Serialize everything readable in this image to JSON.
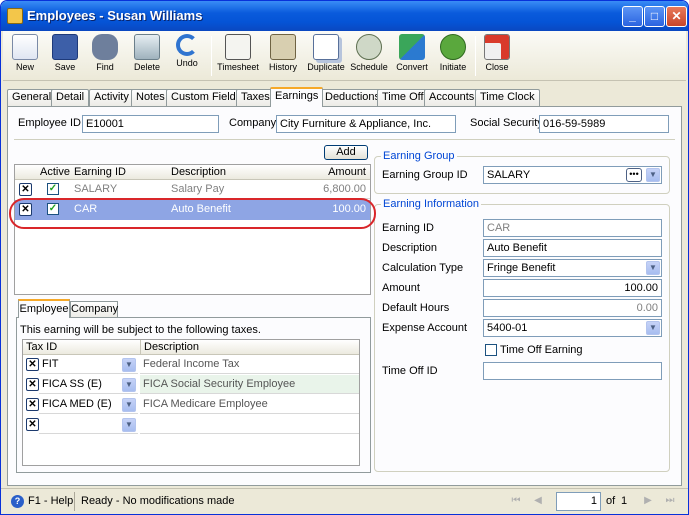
{
  "window": {
    "title": "Employees - Susan Williams"
  },
  "toolbar": {
    "new": "New",
    "save": "Save",
    "find": "Find",
    "delete": "Delete",
    "undo": "Undo",
    "timesheet": "Timesheet",
    "history": "History",
    "duplicate": "Duplicate",
    "schedule": "Schedule",
    "convert": "Convert",
    "initiate": "Initiate",
    "close": "Close"
  },
  "tabs": [
    "General",
    "Detail",
    "Activity",
    "Notes",
    "Custom Fields",
    "Taxes",
    "Earnings",
    "Deductions",
    "Time Off",
    "Accounts",
    "Time Clock"
  ],
  "header": {
    "employee_id_label": "Employee ID",
    "employee_id": "E10001",
    "company_label": "Company",
    "company": "City Furniture & Appliance, Inc.",
    "ssn_label": "Social Security",
    "ssn": "016-59-5989"
  },
  "earnings": {
    "add_label": "Add",
    "columns": [
      "Active",
      "Earning ID",
      "Description",
      "Amount"
    ],
    "rows": [
      {
        "earning_id": "SALARY",
        "description": "Salary Pay",
        "amount": "6,800.00"
      },
      {
        "earning_id": "CAR",
        "description": "Auto Benefit",
        "amount": "100.00"
      }
    ]
  },
  "subtabs": [
    "Employee",
    "Company"
  ],
  "taxes": {
    "note": "This earning will be subject to the following taxes.",
    "columns": [
      "Tax ID",
      "Description"
    ],
    "rows": [
      {
        "tax_id": "FIT",
        "description": "Federal Income Tax"
      },
      {
        "tax_id": "FICA SS (E)",
        "description": "FICA Social Security Employee"
      },
      {
        "tax_id": "FICA MED (E)",
        "description": "FICA Medicare Employee"
      }
    ]
  },
  "earning_group": {
    "title": "Earning Group",
    "id_label": "Earning Group ID",
    "id": "SALARY"
  },
  "earning_info": {
    "title": "Earning Information",
    "earning_id_label": "Earning ID",
    "earning_id": "CAR",
    "description_label": "Description",
    "description": "Auto Benefit",
    "calc_type_label": "Calculation Type",
    "calc_type": "Fringe Benefit",
    "amount_label": "Amount",
    "amount": "100.00",
    "default_hours_label": "Default Hours",
    "default_hours": "0.00",
    "expense_account_label": "Expense Account",
    "expense_account": "5400-01",
    "time_off_earning_label": "Time Off Earning",
    "time_off_id_label": "Time Off ID",
    "time_off_id": ""
  },
  "status": {
    "help": "F1 - Help",
    "message": "Ready - No modifications made",
    "page": "1",
    "of_label": "of",
    "total": "1"
  },
  "colors": {
    "title_bar": "#0a5bdc",
    "selected_row": "#8ea5e4",
    "highlight_oval": "#d9262a",
    "group_title": "#0046d5"
  }
}
